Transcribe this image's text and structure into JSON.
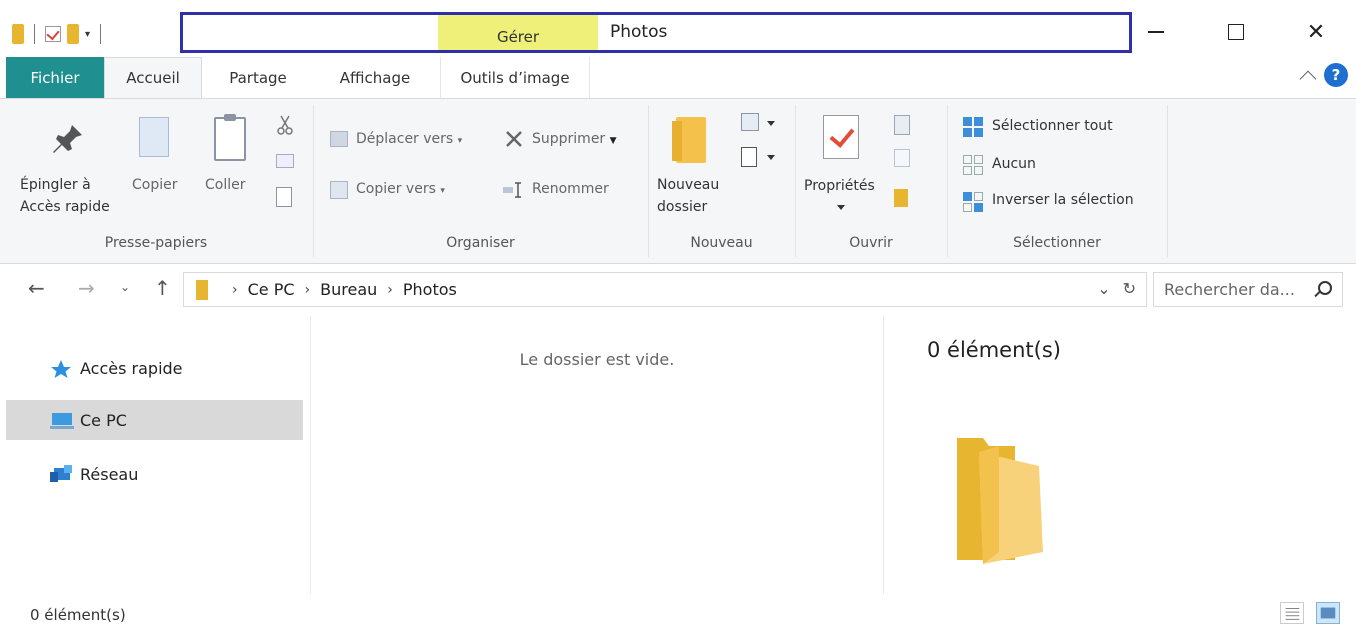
{
  "window": {
    "context_tab": "Gérer",
    "title": "Photos",
    "minimize": "—",
    "maximize": "☐",
    "close": "✕"
  },
  "tabs": [
    {
      "label": "Fichier"
    },
    {
      "label": "Accueil"
    },
    {
      "label": "Partage"
    },
    {
      "label": "Affichage"
    },
    {
      "label": "Outils d’image"
    }
  ],
  "help_label": "?",
  "ribbon": {
    "clipboard": {
      "pin_line1": "Épingler à",
      "pin_line2": "Accès rapide",
      "copy": "Copier",
      "paste": "Coller",
      "label": "Presse-papiers"
    },
    "organize": {
      "move_to": "Déplacer vers",
      "copy_to": "Copier vers",
      "delete": "Supprimer",
      "rename": "Renommer",
      "label": "Organiser"
    },
    "new": {
      "new_folder_line1": "Nouveau",
      "new_folder_line2": "dossier",
      "label": "Nouveau"
    },
    "open": {
      "properties": "Propriétés",
      "label": "Ouvrir"
    },
    "select": {
      "select_all": "Sélectionner tout",
      "select_none": "Aucun",
      "invert": "Inverser la sélection",
      "label": "Sélectionner"
    }
  },
  "address": {
    "crumbs": [
      "Ce PC",
      "Bureau",
      "Photos"
    ],
    "search_placeholder": "Rechercher da..."
  },
  "nav_pane": {
    "items": [
      {
        "label": "Accès rapide"
      },
      {
        "label": "Ce PC"
      },
      {
        "label": "Réseau"
      }
    ]
  },
  "content": {
    "empty_message": "Le dossier est vide."
  },
  "preview": {
    "count": "0 élément(s)"
  },
  "status": {
    "count": "0 élément(s)"
  },
  "colors": {
    "file_tab": "#1f8f8f",
    "manage_tab": "#eef07a",
    "title_highlight": "#2f2fa8",
    "folder": "#f4c24a",
    "help": "#1e6fd0"
  }
}
